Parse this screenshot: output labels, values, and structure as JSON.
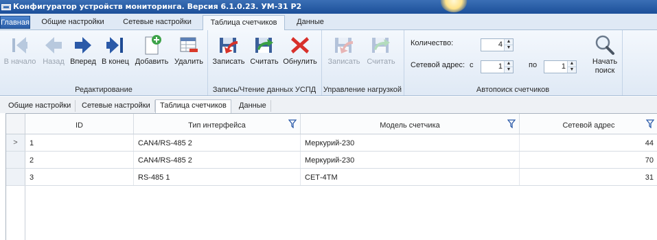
{
  "window": {
    "title": "Конфигуратор устройств мониторинга. Версия 6.1.0.23. УМ-31 Р2"
  },
  "ribbon_tabs": [
    {
      "label": "Главная"
    },
    {
      "label": "Общие настройки"
    },
    {
      "label": "Сетевые настройки"
    },
    {
      "label": "Таблица счетчиков"
    },
    {
      "label": "Данные"
    }
  ],
  "ribbon": {
    "edit": {
      "label": "Редактирование",
      "buttons": [
        {
          "label": "В начало",
          "icon": "first-icon",
          "enabled": false
        },
        {
          "label": "Назад",
          "icon": "prev-icon",
          "enabled": false
        },
        {
          "label": "Вперед",
          "icon": "next-icon",
          "enabled": true
        },
        {
          "label": "В конец",
          "icon": "last-icon",
          "enabled": true
        },
        {
          "label": "Добавить",
          "icon": "add-icon",
          "enabled": true
        },
        {
          "label": "Удалить",
          "icon": "delete-icon",
          "enabled": true
        }
      ]
    },
    "rw": {
      "label": "Запись/Чтение данных УСПД",
      "buttons": [
        {
          "label": "Записать",
          "icon": "write-icon",
          "enabled": true
        },
        {
          "label": "Считать",
          "icon": "read-icon",
          "enabled": true
        },
        {
          "label": "Обнулить",
          "icon": "reset-icon",
          "enabled": true
        }
      ]
    },
    "load": {
      "label": "Управление нагрузкой",
      "buttons": [
        {
          "label": "Записать",
          "icon": "write-icon",
          "enabled": false
        },
        {
          "label": "Считать",
          "icon": "read-icon",
          "enabled": false
        }
      ]
    },
    "autosearch": {
      "label": "Автопоиск счетчиков",
      "count_label": "Количество:",
      "count_value": "4",
      "address_label": "Сетевой адрес:",
      "from_label": "с",
      "from_value": "1",
      "to_label": "по",
      "to_value": "1",
      "start_label_1": "Начать",
      "start_label_2": "поиск"
    }
  },
  "page_tabs": [
    {
      "label": "Общие настройки"
    },
    {
      "label": "Сетевые настройки"
    },
    {
      "label": "Таблица счетчиков"
    },
    {
      "label": "Данные"
    }
  ],
  "grid": {
    "columns": [
      "ID",
      "Тип интерфейса",
      "Модель счетчика",
      "Сетевой адрес"
    ],
    "current_row_marker": ">",
    "rows": [
      {
        "id": "1",
        "interface": "CAN4/RS-485 2",
        "model": "Меркурий-230",
        "address": "44"
      },
      {
        "id": "2",
        "interface": "CAN4/RS-485 2",
        "model": "Меркурий-230",
        "address": "70"
      },
      {
        "id": "3",
        "interface": "RS-485 1",
        "model": "СЕТ-4ТМ",
        "address": "31"
      }
    ]
  },
  "colors": {
    "accent": "#1c4f99",
    "ribbon_bg": "#dfe9f5",
    "disabled_text": "#9aa4b0"
  }
}
